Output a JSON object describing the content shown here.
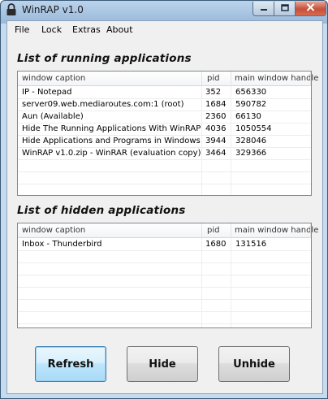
{
  "window": {
    "title": "WinRAP v1.0"
  },
  "menu": {
    "items": [
      "File",
      "Lock",
      "Extras",
      "About"
    ]
  },
  "running": {
    "title": "List of running applications",
    "columns": [
      "window caption",
      "pid",
      "main window handle"
    ],
    "rows": [
      [
        "IP - Notepad",
        "352",
        "656330"
      ],
      [
        "server09.web.mediaroutes.com:1 (root)",
        "1684",
        "590782"
      ],
      [
        "Aun (Available)",
        "2360",
        "66130"
      ],
      [
        "Hide The Running Applications With WinRAP - Wi...",
        "4036",
        "1050554"
      ],
      [
        "Hide Applications and Programs in Windows- Win...",
        "3944",
        "328046"
      ],
      [
        "WinRAP v1.0.zip - WinRAR (evaluation copy)",
        "3464",
        "329366"
      ]
    ]
  },
  "hidden": {
    "title": "List of hidden applications",
    "columns": [
      "window caption",
      "pid",
      "main window handle"
    ],
    "rows": [
      [
        "Inbox - Thunderbird",
        "1680",
        "131516"
      ]
    ]
  },
  "buttons": {
    "refresh": "Refresh",
    "hide": "Hide",
    "unhide": "Unhide"
  },
  "colors": {
    "titlebar": "#a9c6e3",
    "close_button": "#c4503a",
    "client_bg": "#f0f0f0",
    "focus_border": "#3c7fb1"
  },
  "icons": {
    "app": "padlock-icon",
    "minimize": "minimize-icon",
    "maximize": "maximize-icon",
    "close": "close-icon"
  }
}
